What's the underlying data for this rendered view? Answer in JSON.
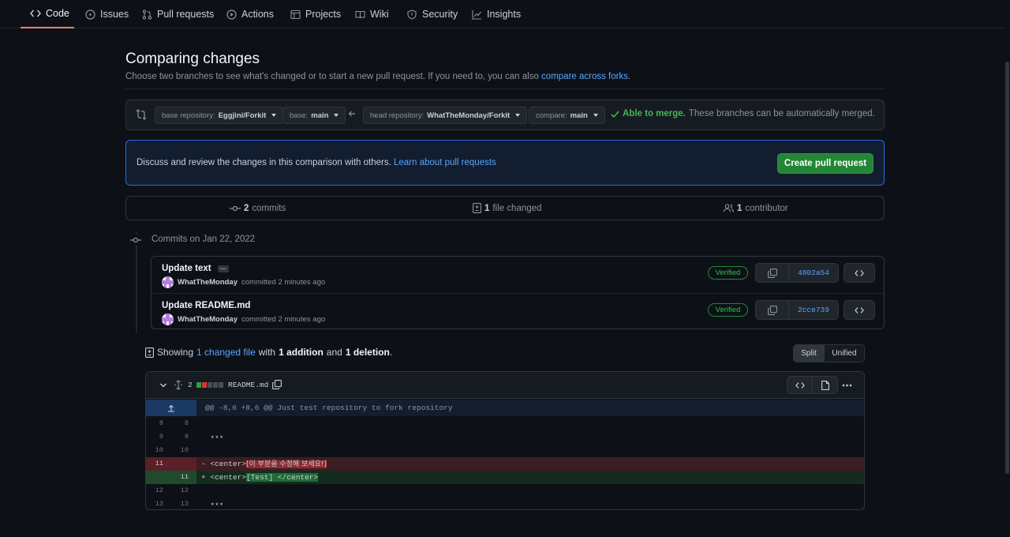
{
  "nav": {
    "tabs": [
      {
        "label": "Code",
        "icon": "code-icon",
        "active": true
      },
      {
        "label": "Issues",
        "icon": "issue-icon"
      },
      {
        "label": "Pull requests",
        "icon": "pull-request-icon"
      },
      {
        "label": "Actions",
        "icon": "play-icon"
      },
      {
        "label": "Projects",
        "icon": "table-icon"
      },
      {
        "label": "Wiki",
        "icon": "book-icon"
      },
      {
        "label": "Security",
        "icon": "shield-icon"
      },
      {
        "label": "Insights",
        "icon": "graph-icon"
      }
    ]
  },
  "header": {
    "title": "Comparing changes",
    "subtitle_prefix": "Choose two branches to see what's changed or to start a new pull request. If you need to, you can also ",
    "subtitle_link": "compare across forks",
    "subtitle_suffix": "."
  },
  "range": {
    "base_repo_label": "base repository: ",
    "base_repo_value": "Eggjini/Forkit",
    "base_label": "base: ",
    "base_value": "main",
    "head_repo_label": "head repository: ",
    "head_repo_value": "WhatTheMonday/Forkit",
    "compare_label": "compare: ",
    "compare_value": "main",
    "merge_ok": "Able to merge.",
    "merge_text": "These branches can be automatically merged."
  },
  "banner": {
    "text": "Discuss and review the changes in this comparison with others. ",
    "link": "Learn about pull requests",
    "button": "Create pull request"
  },
  "summary": {
    "commits_count": "2",
    "commits_label": "commits",
    "files_count": "1",
    "files_label": "file changed",
    "contributors_count": "1",
    "contributors_label": "contributor"
  },
  "commits": {
    "date_label": "Commits on Jan 22, 2022",
    "items": [
      {
        "title": "Update text",
        "author": "WhatTheMonday",
        "meta": "committed 2 minutes ago",
        "badge": "Verified",
        "sha": "4802a54",
        "has_more": true
      },
      {
        "title": "Update README.md",
        "author": "WhatTheMonday",
        "meta": "committed 2 minutes ago",
        "badge": "Verified",
        "sha": "2cce739",
        "has_more": false
      }
    ]
  },
  "diff_summary": {
    "showing": "Showing",
    "changed_link": "1 changed file",
    "with": "with",
    "additions": "1 addition",
    "and": "and",
    "deletions": "1 deletion",
    "period": ".",
    "split": "Split",
    "unified": "Unified"
  },
  "file": {
    "change_count": "2",
    "name": "README.md",
    "hunk": "@@ -8,6 +8,6 @@ Just test repository to fork repository",
    "lines": [
      {
        "type": "ctx",
        "old": "8",
        "new": "8",
        "code": ""
      },
      {
        "type": "ctx",
        "old": "9",
        "new": "9",
        "code": "  ***"
      },
      {
        "type": "ctx",
        "old": "10",
        "new": "10",
        "code": ""
      },
      {
        "type": "del",
        "old": "11",
        "new": "",
        "prefix": "- <center>",
        "highlight": "[이 부분을 수정해 보세요!]",
        "suffix": ""
      },
      {
        "type": "add",
        "old": "",
        "new": "11",
        "prefix": "+ <center>",
        "highlight": "[Test] </center>",
        "suffix": ""
      },
      {
        "type": "ctx",
        "old": "12",
        "new": "12",
        "code": ""
      },
      {
        "type": "ctx",
        "old": "13",
        "new": "13",
        "code": "  ***"
      }
    ]
  },
  "colors": {
    "accent": "#58a6ff",
    "success": "#3fb950",
    "button_green": "#238636",
    "danger": "#f85149",
    "background": "#0d1117"
  }
}
